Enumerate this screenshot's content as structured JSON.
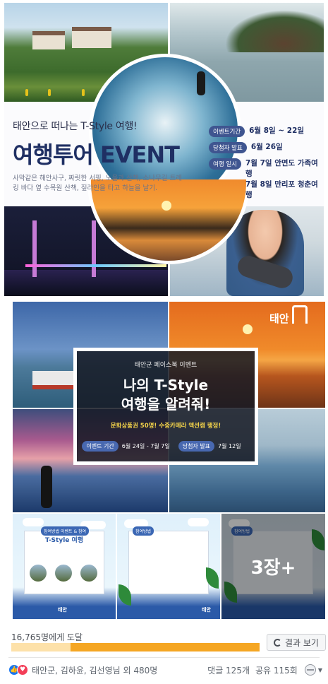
{
  "banner": {
    "tagline": "태안으로 떠나는 T-Style 여행!",
    "title": "여행투어 EVENT",
    "desc": "사막같은 해안사구, 짜릿한 서핑, 노을과 산책, 소나무길 트레킹 바다 옆 수목원 산책, 짚라인을 타고 하늘을 날기.",
    "schedule": [
      {
        "label": "이벤트기간",
        "values": [
          "6월 8일 ~ 22일"
        ]
      },
      {
        "label": "당첨자 발표",
        "values": [
          "6월 26일"
        ]
      },
      {
        "label": "여행 일시",
        "values": [
          "7월 7일 안면도 가족여행",
          "7월 8일 만리포 청춘여행"
        ]
      }
    ]
  },
  "grid": {
    "logo_text": "태안",
    "promo": {
      "label": "태안군 페이스북 이벤트",
      "title_line1": "나의 T-Style",
      "title_line2": "여행을 알려줘!",
      "prize": "문화상품권 50명! 수중카메라 액션캠 행정!",
      "period_label": "이벤트 기간",
      "period_value": "6월 24일 - 7월 7일",
      "announce_label": "당첨자 발표",
      "announce_value": "7월 12일"
    }
  },
  "cards": {
    "a_label": "참여방법 이벤트 & 참여",
    "a_title": "T-Style 여행",
    "b_label": "참여방법",
    "c_label": "참여방법",
    "logo": "태안",
    "more": "3장+"
  },
  "reach": {
    "text": "16,765명에게 도달",
    "progress": 0.24,
    "button": "결과 보기"
  },
  "footer": {
    "reactors": "태안군, 김하윤, 김선영님 외 480명",
    "comments": "댓글 125개",
    "shares": "공유 115회"
  },
  "colors": {
    "title_navy": "#1f2f63",
    "pill_blue": "#3f5590",
    "progress_orange": "#f5a623",
    "like_blue": "#1877f2",
    "love_red": "#f33e58"
  }
}
